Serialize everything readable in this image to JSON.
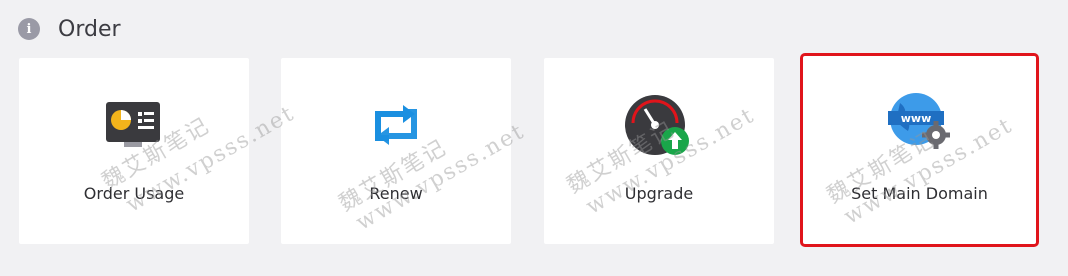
{
  "section": {
    "icon": "info-icon",
    "title": "Order"
  },
  "cards": [
    {
      "label": "Order Usage",
      "icon": "dashboard-chart-icon"
    },
    {
      "label": "Renew",
      "icon": "renew-arrows-icon"
    },
    {
      "label": "Upgrade",
      "icon": "speedometer-upgrade-icon"
    },
    {
      "label": "Set Main Domain",
      "icon": "www-globe-gear-icon",
      "highlighted": true
    }
  ],
  "watermark": {
    "name": "魏艾斯笔记",
    "url": "www.vpsss.net"
  },
  "colors": {
    "background": "#f1f1f3",
    "card": "#ffffff",
    "highlight": "#e0141b",
    "renew_blue": "#1a8fe0",
    "upgrade_green": "#1aa64a",
    "globe_blue": "#3d9be9"
  }
}
